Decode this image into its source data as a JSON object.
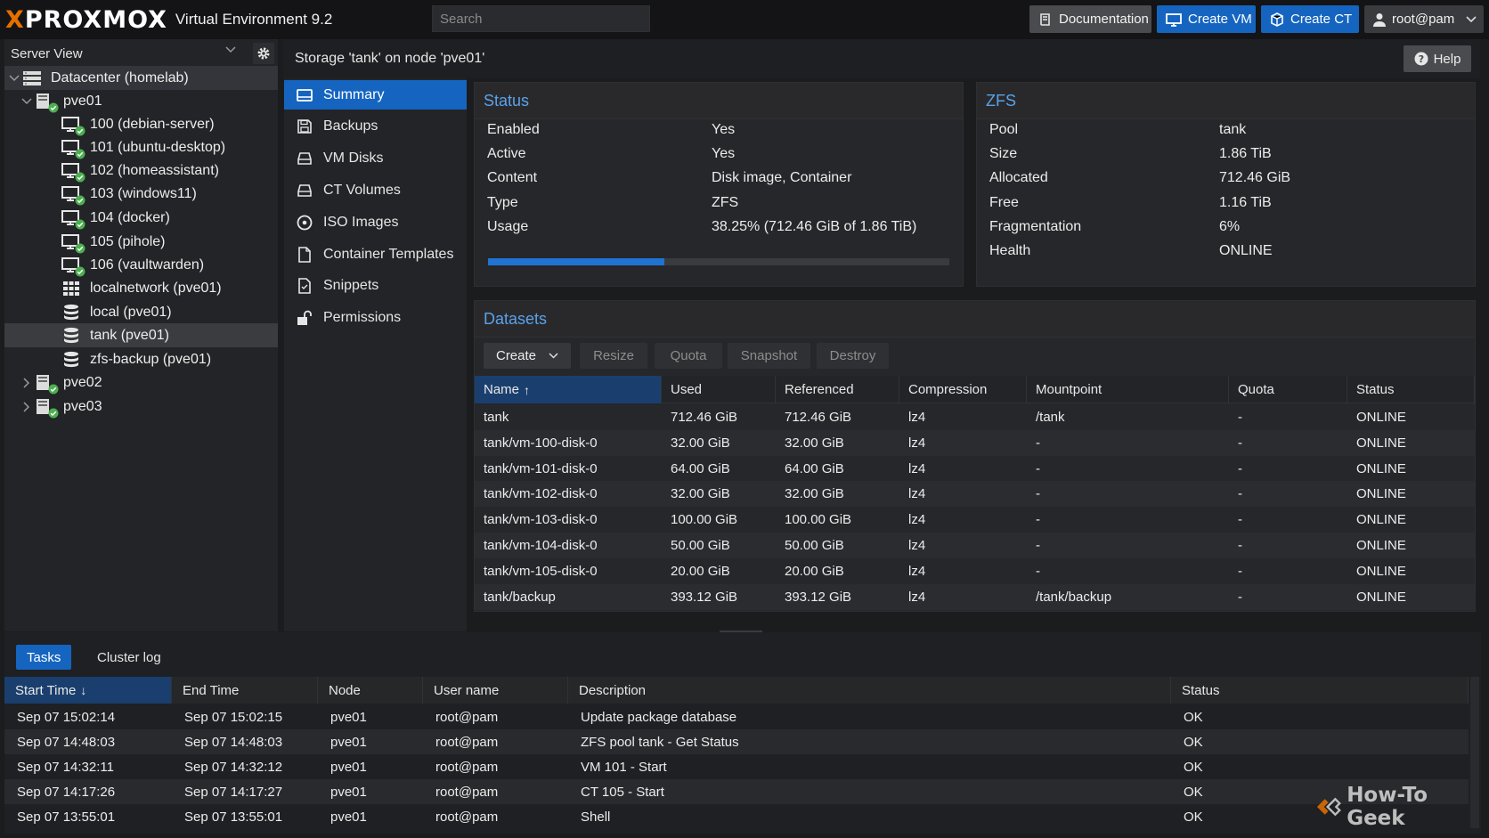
{
  "header": {
    "logo_text": "PROXMOX",
    "logo_x": "X",
    "product": "Virtual Environment 9.2",
    "search_placeholder": "Search",
    "buttons": {
      "documentation": "Documentation",
      "create_vm": "Create VM",
      "create_ct": "Create CT",
      "user": "root@pam"
    }
  },
  "tree": {
    "view": "Server View",
    "items": [
      {
        "label": "Datacenter (homelab)",
        "icon": "datacenter-icon"
      },
      {
        "label": "pve01",
        "icon": "node-icon"
      },
      {
        "label": "100 (debian-server)",
        "icon": "vm-icon"
      },
      {
        "label": "101 (ubuntu-desktop)",
        "icon": "vm-icon"
      },
      {
        "label": "102 (homeassistant)",
        "icon": "vm-icon"
      },
      {
        "label": "103 (windows11)",
        "icon": "vm-icon"
      },
      {
        "label": "104 (docker)",
        "icon": "vm-icon"
      },
      {
        "label": "105 (pihole)",
        "icon": "vm-icon"
      },
      {
        "label": "106 (vaultwarden)",
        "icon": "vm-icon"
      },
      {
        "label": "localnetwork (pve01)",
        "icon": "network-grid-icon"
      },
      {
        "label": "local (pve01)",
        "icon": "storage-icon"
      },
      {
        "label": "tank (pve01)",
        "icon": "storage-icon"
      },
      {
        "label": "zfs-backup (pve01)",
        "icon": "storage-icon"
      },
      {
        "label": "pve02",
        "icon": "node-icon"
      },
      {
        "label": "pve03",
        "icon": "node-icon"
      }
    ]
  },
  "content": {
    "title": "Storage 'tank' on node 'pve01'",
    "help": "Help"
  },
  "nav": [
    {
      "label": "Summary",
      "icon": "summary-icon"
    },
    {
      "label": "Backups",
      "icon": "floppy-icon"
    },
    {
      "label": "VM Disks",
      "icon": "disk-icon"
    },
    {
      "label": "CT Volumes",
      "icon": "disk-icon"
    },
    {
      "label": "ISO Images",
      "icon": "iso-icon"
    },
    {
      "label": "Container Templates",
      "icon": "file-icon"
    },
    {
      "label": "Snippets",
      "icon": "snippet-icon"
    },
    {
      "label": "Permissions",
      "icon": "unlock-icon"
    }
  ],
  "status": {
    "title": "Status",
    "rows": [
      {
        "k": "Enabled",
        "v": "Yes"
      },
      {
        "k": "Active",
        "v": "Yes"
      },
      {
        "k": "Content",
        "v": "Disk image, Container"
      },
      {
        "k": "Type",
        "v": "ZFS"
      },
      {
        "k": "Usage",
        "v": "38.25% (712.46 GiB of 1.86 TiB)"
      }
    ],
    "usage_percent": 38.25,
    "bar_color": "#1f73d1"
  },
  "zfs": {
    "title": "ZFS",
    "rows": [
      {
        "k": "Pool",
        "v": "tank"
      },
      {
        "k": "Size",
        "v": "1.86 TiB"
      },
      {
        "k": "Allocated",
        "v": "712.46 GiB"
      },
      {
        "k": "Free",
        "v": "1.16 TiB"
      },
      {
        "k": "Fragmentation",
        "v": "6%"
      },
      {
        "k": "Health",
        "v": "ONLINE"
      }
    ]
  },
  "datasets": {
    "title": "Datasets",
    "buttons": {
      "create": "Create",
      "resize": "Resize",
      "quota": "Quota",
      "snapshot": "Snapshot",
      "destroy": "Destroy"
    },
    "columns": [
      "Name",
      "Used",
      "Referenced",
      "Compression",
      "Mountpoint",
      "Quota",
      "Status"
    ],
    "sort_arrow": "↑",
    "rows": [
      [
        "tank",
        "712.46 GiB",
        "712.46 GiB",
        "lz4",
        "/tank",
        "-",
        "ONLINE"
      ],
      [
        "tank/vm-100-disk-0",
        "32.00 GiB",
        "32.00 GiB",
        "lz4",
        "-",
        "-",
        "ONLINE"
      ],
      [
        "tank/vm-101-disk-0",
        "64.00 GiB",
        "64.00 GiB",
        "lz4",
        "-",
        "-",
        "ONLINE"
      ],
      [
        "tank/vm-102-disk-0",
        "32.00 GiB",
        "32.00 GiB",
        "lz4",
        "-",
        "-",
        "ONLINE"
      ],
      [
        "tank/vm-103-disk-0",
        "100.00 GiB",
        "100.00 GiB",
        "lz4",
        "-",
        "-",
        "ONLINE"
      ],
      [
        "tank/vm-104-disk-0",
        "50.00 GiB",
        "50.00 GiB",
        "lz4",
        "-",
        "-",
        "ONLINE"
      ],
      [
        "tank/vm-105-disk-0",
        "20.00 GiB",
        "20.00 GiB",
        "lz4",
        "-",
        "-",
        "ONLINE"
      ],
      [
        "tank/backup",
        "393.12 GiB",
        "393.12 GiB",
        "lz4",
        "/tank/backup",
        "-",
        "ONLINE"
      ]
    ]
  },
  "tasks": {
    "tabs": [
      "Tasks",
      "Cluster log"
    ],
    "columns": [
      "Start Time",
      "End Time",
      "Node",
      "User name",
      "Description",
      "Status"
    ],
    "sort_arrow": "↓",
    "rows": [
      [
        "Sep 07 15:02:14",
        "Sep 07 15:02:15",
        "pve01",
        "root@pam",
        "Update package database",
        "OK"
      ],
      [
        "Sep 07 14:48:03",
        "Sep 07 14:48:03",
        "pve01",
        "root@pam",
        "ZFS pool tank - Get Status",
        "OK"
      ],
      [
        "Sep 07 14:32:11",
        "Sep 07 14:32:12",
        "pve01",
        "root@pam",
        "VM 101 - Start",
        "OK"
      ],
      [
        "Sep 07 14:17:26",
        "Sep 07 14:17:27",
        "pve01",
        "root@pam",
        "CT 105 - Start",
        "OK"
      ],
      [
        "Sep 07 13:55:01",
        "Sep 07 13:55:01",
        "pve01",
        "root@pam",
        "Shell",
        "OK"
      ]
    ]
  },
  "watermark": "How-To Geek",
  "colors": {
    "accent": "#1565c0",
    "logo_orange": "#e57000",
    "heading_blue": "#5aa2e8",
    "ok_green": "#4caf50"
  }
}
